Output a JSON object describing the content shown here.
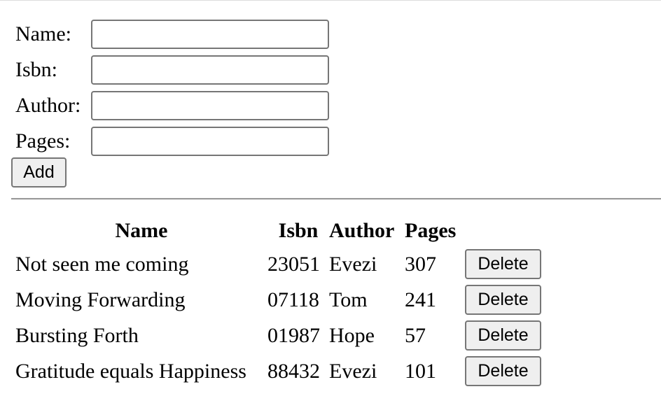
{
  "form": {
    "fields": [
      {
        "label": "Name:",
        "value": ""
      },
      {
        "label": "Isbn:",
        "value": ""
      },
      {
        "label": "Author:",
        "value": ""
      },
      {
        "label": "Pages:",
        "value": ""
      }
    ],
    "add_label": "Add"
  },
  "table": {
    "headers": {
      "name": "Name",
      "isbn": "Isbn",
      "author": "Author",
      "pages": "Pages"
    },
    "rows": [
      {
        "name": "Not seen me coming",
        "isbn": "23051",
        "author": "Evezi",
        "pages": "307",
        "action": "Delete"
      },
      {
        "name": "Moving Forwarding",
        "isbn": "07118",
        "author": "Tom",
        "pages": "241",
        "action": "Delete"
      },
      {
        "name": "Bursting Forth",
        "isbn": "01987",
        "author": "Hope",
        "pages": "57",
        "action": "Delete"
      },
      {
        "name": "Gratitude equals Happiness",
        "isbn": "88432",
        "author": "Evezi",
        "pages": "101",
        "action": "Delete"
      }
    ]
  }
}
